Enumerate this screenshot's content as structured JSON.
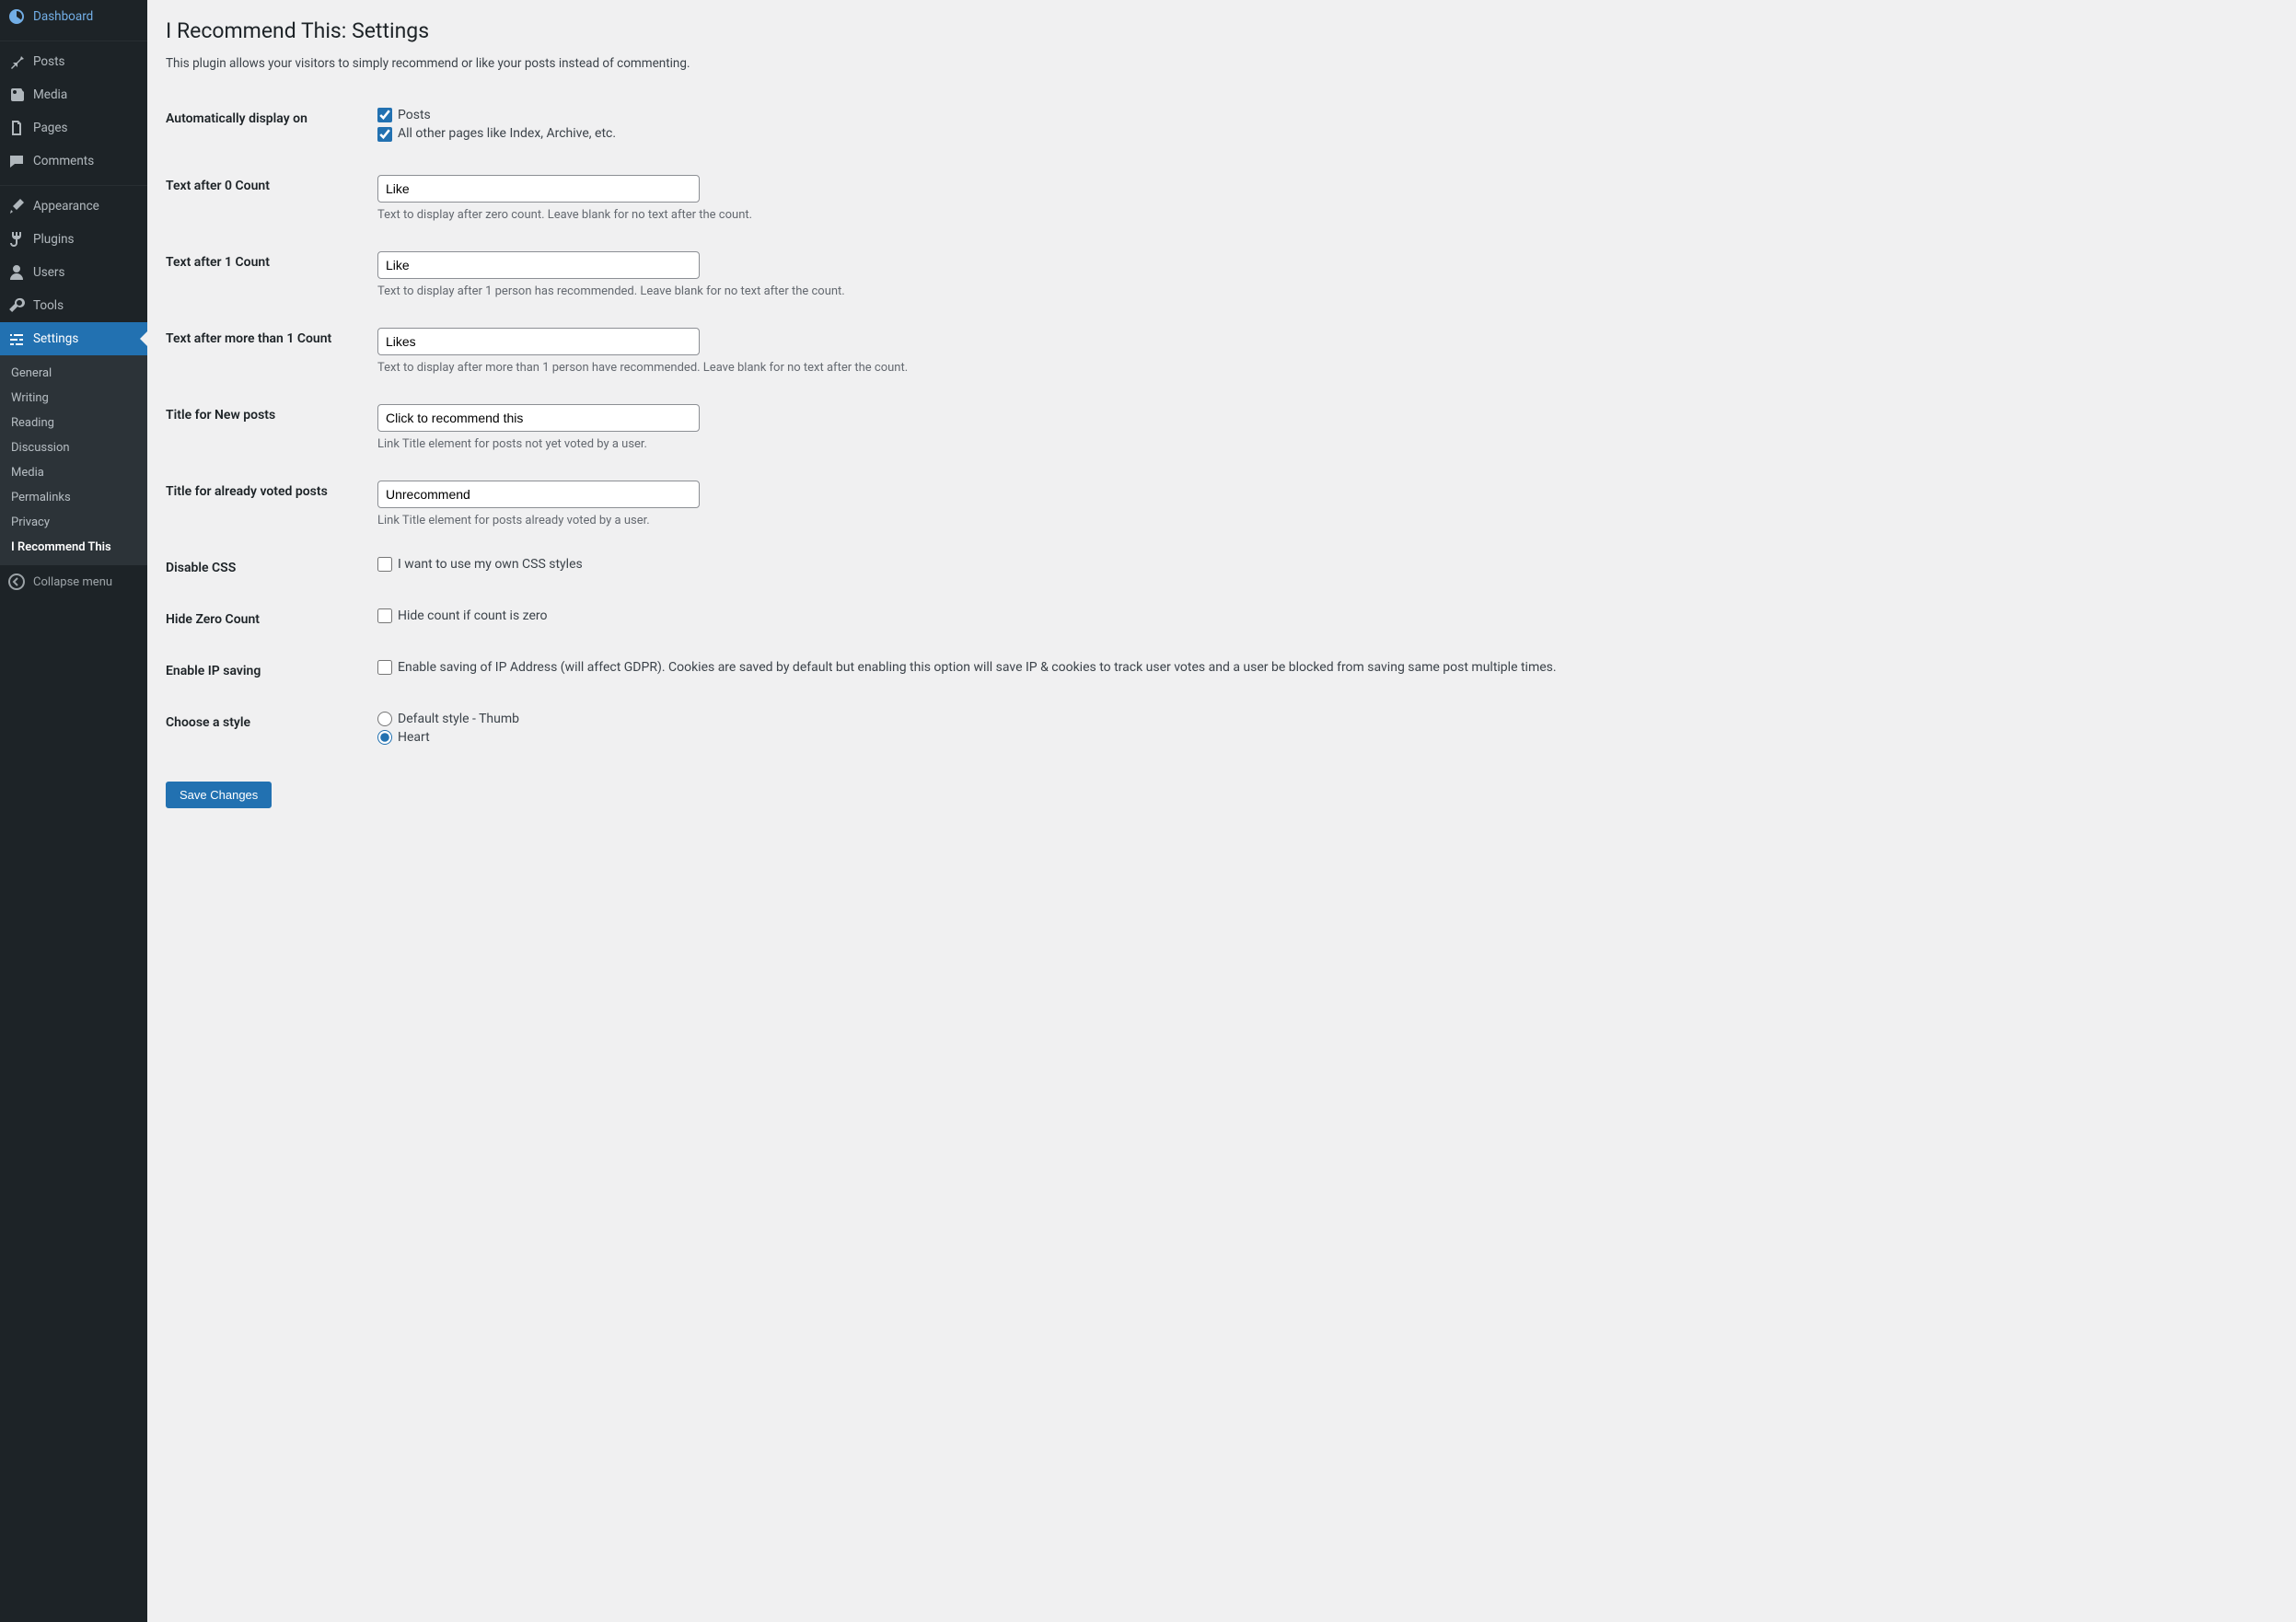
{
  "sidebar": {
    "dashboard": "Dashboard",
    "posts": "Posts",
    "media": "Media",
    "pages": "Pages",
    "comments": "Comments",
    "appearance": "Appearance",
    "plugins": "Plugins",
    "users": "Users",
    "tools": "Tools",
    "settings": "Settings",
    "submenu": {
      "general": "General",
      "writing": "Writing",
      "reading": "Reading",
      "discussion": "Discussion",
      "media": "Media",
      "permalinks": "Permalinks",
      "privacy": "Privacy",
      "irecommendthis": "I Recommend This"
    },
    "collapse": "Collapse menu"
  },
  "page": {
    "title": "I Recommend This: Settings",
    "intro": "This plugin allows your visitors to simply recommend or like your posts instead of commenting."
  },
  "fields": {
    "auto_display": {
      "label": "Automatically display on",
      "posts": "Posts",
      "other": "All other pages like Index, Archive, etc."
    },
    "zero": {
      "label": "Text after 0 Count",
      "value": "Like",
      "desc": "Text to display after zero count. Leave blank for no text after the count."
    },
    "one": {
      "label": "Text after 1 Count",
      "value": "Like",
      "desc": "Text to display after 1 person has recommended. Leave blank for no text after the count."
    },
    "more": {
      "label": "Text after more than 1 Count",
      "value": "Likes",
      "desc": "Text to display after more than 1 person have recommended. Leave blank for no text after the count."
    },
    "title_new": {
      "label": "Title for New posts",
      "value": "Click to recommend this",
      "desc": "Link Title element for posts not yet voted by a user."
    },
    "title_voted": {
      "label": "Title for already voted posts",
      "value": "Unrecommend",
      "desc": "Link Title element for posts already voted by a user."
    },
    "disable_css": {
      "label": "Disable CSS",
      "cb": "I want to use my own CSS styles"
    },
    "hide_zero": {
      "label": "Hide Zero Count",
      "cb": "Hide count if count is zero"
    },
    "enable_ip": {
      "label": "Enable IP saving",
      "cb": "Enable saving of IP Address (will affect GDPR). Cookies are saved by default but enabling this option will save IP & cookies to track user votes and a user be blocked from saving same post multiple times."
    },
    "style": {
      "label": "Choose a style",
      "thumb": "Default style - Thumb",
      "heart": "Heart"
    }
  },
  "submit": "Save Changes"
}
